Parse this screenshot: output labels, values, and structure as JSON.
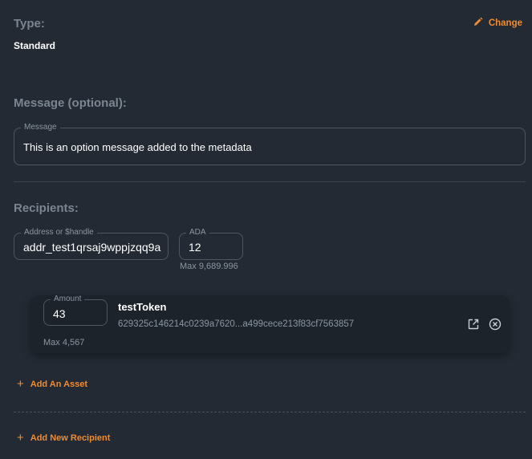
{
  "type_section": {
    "title": "Type:",
    "value": "Standard",
    "change_label": "Change"
  },
  "message_section": {
    "title": "Message (optional):",
    "field_label": "Message",
    "field_value": "This is an option message added to the metadata"
  },
  "recipients_section": {
    "title": "Recipients:",
    "address": {
      "label": "Address or $handle",
      "value": "addr_test1qrsaj9wppjzqq9a"
    },
    "ada": {
      "label": "ADA",
      "value": "12",
      "max": "Max 9,689.996"
    },
    "asset": {
      "amount_label": "Amount",
      "amount_value": "43",
      "max": "Max 4,567",
      "name": "testToken",
      "policy": "629325c146214c0239a7620...a499cece213f83cf7563857"
    },
    "add_asset_label": "Add An Asset",
    "add_recipient_label": "Add New Recipient"
  },
  "icons": {
    "change": "pencil-icon",
    "external": "external-link-icon",
    "remove": "close-circle-icon",
    "add": "plus-icon"
  },
  "colors": {
    "background": "#232a33",
    "accent": "#f08b32",
    "card": "#1d232b",
    "muted": "#7b8591"
  }
}
